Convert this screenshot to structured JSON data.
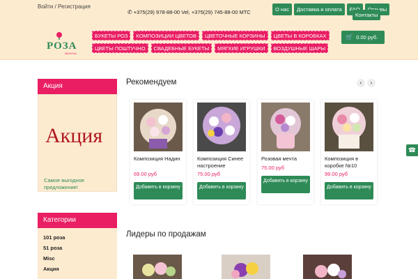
{
  "topbar": {
    "login": "Войти / Регистрация",
    "phones": "+375(29) 978-88-00 Vel, +375(29) 745-88-00 МТС",
    "nav": [
      "О нас",
      "Доставка и оплата",
      "FAQ",
      "Отзывы"
    ],
    "contacts": "Контакты"
  },
  "logo": {
    "text": "РОЗА",
    "sub": "МИНСКА"
  },
  "categories": {
    "row1": [
      "БУКЕТЫ РОЗ",
      "КОМПОЗИЦИИ ЦВЕТОВ",
      "ЦВЕТОЧНЫЕ КОРЗИНЫ",
      "ЦВЕТЫ В КОРОБКАХ"
    ],
    "row2": [
      "ЦВЕТЫ ПОШТУЧНО",
      "СВАДЕБНЫЕ БУКЕТЫ",
      "МЯГКИЕ ИГРУШКИ",
      "ВОЗДУШНЫЕ ШАРЫ"
    ]
  },
  "cart": {
    "amount": "0.00 руб."
  },
  "promo": {
    "header": "Акция",
    "title": "Акция",
    "description": "Самое выгодное предложение!"
  },
  "category_panel": {
    "header": "Категории",
    "items": [
      "101 роза",
      "51 роза",
      "Misc",
      "Акция"
    ]
  },
  "recommended": {
    "title": "Рекомендуем",
    "products": [
      {
        "name": "Композиция Надин",
        "price": "69.00 руб",
        "button": "Добавить в корзину"
      },
      {
        "name": "Композиция Синее настроение",
        "price": "75.00 руб",
        "button": "Добавить в корзину"
      },
      {
        "name": "Розовая мечта",
        "price": "75.00 руб",
        "button": "Добавить в корзину"
      },
      {
        "name": "Композиция в коробке №10",
        "price": "99.00 руб",
        "button": "Добавить в корзину"
      }
    ]
  },
  "bestsellers": {
    "title": "Лидеры по продажам"
  },
  "colors": {
    "accent": "#e91e63",
    "green": "#2e8b57",
    "cream": "#fdebd0"
  }
}
